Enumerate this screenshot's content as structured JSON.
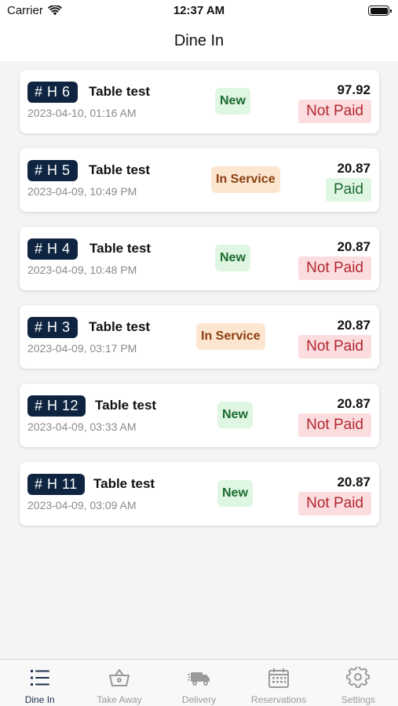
{
  "status_bar": {
    "carrier": "Carrier",
    "time": "12:37 AM"
  },
  "nav": {
    "title": "Dine In"
  },
  "orders": [
    {
      "table": "# H 6",
      "name": "Table test",
      "date": "2023-04-10, 01:16 AM",
      "status": "New",
      "amount": "97.92",
      "payment": "Not Paid"
    },
    {
      "table": "# H 5",
      "name": "Table test",
      "date": "2023-04-09, 10:49 PM",
      "status": "In Service",
      "amount": "20.87",
      "payment": "Paid"
    },
    {
      "table": "# H 4",
      "name": "Table test",
      "date": "2023-04-09, 10:48 PM",
      "status": "New",
      "amount": "20.87",
      "payment": "Not Paid"
    },
    {
      "table": "# H 3",
      "name": "Table test",
      "date": "2023-04-09, 03:17 PM",
      "status": "In Service",
      "amount": "20.87",
      "payment": "Not Paid"
    },
    {
      "table": "# H 12",
      "name": "Table test",
      "date": "2023-04-09, 03:33 AM",
      "status": "New",
      "amount": "20.87",
      "payment": "Not Paid"
    },
    {
      "table": "# H 11",
      "name": "Table test",
      "date": "2023-04-09, 03:09 AM",
      "status": "New",
      "amount": "20.87",
      "payment": "Not Paid"
    }
  ],
  "tabs": [
    {
      "label": "Dine In",
      "icon": "list-icon",
      "active": true
    },
    {
      "label": "Take Away",
      "icon": "basket-icon",
      "active": false
    },
    {
      "label": "Delivery",
      "icon": "truck-icon",
      "active": false
    },
    {
      "label": "Reservations",
      "icon": "calendar-icon",
      "active": false
    },
    {
      "label": "Settings",
      "icon": "gear-icon",
      "active": false
    }
  ],
  "colors": {
    "badge": "#0e2440",
    "new_bg": "#dff6e3",
    "new_text": "#1b6a2e",
    "service_bg": "#fde6cf",
    "service_text": "#8a3d10",
    "notpaid_bg": "#fbdde0",
    "notpaid_text": "#b3262e",
    "tab_active": "#1c2f4f",
    "tab_inactive": "#9a9a9a"
  }
}
